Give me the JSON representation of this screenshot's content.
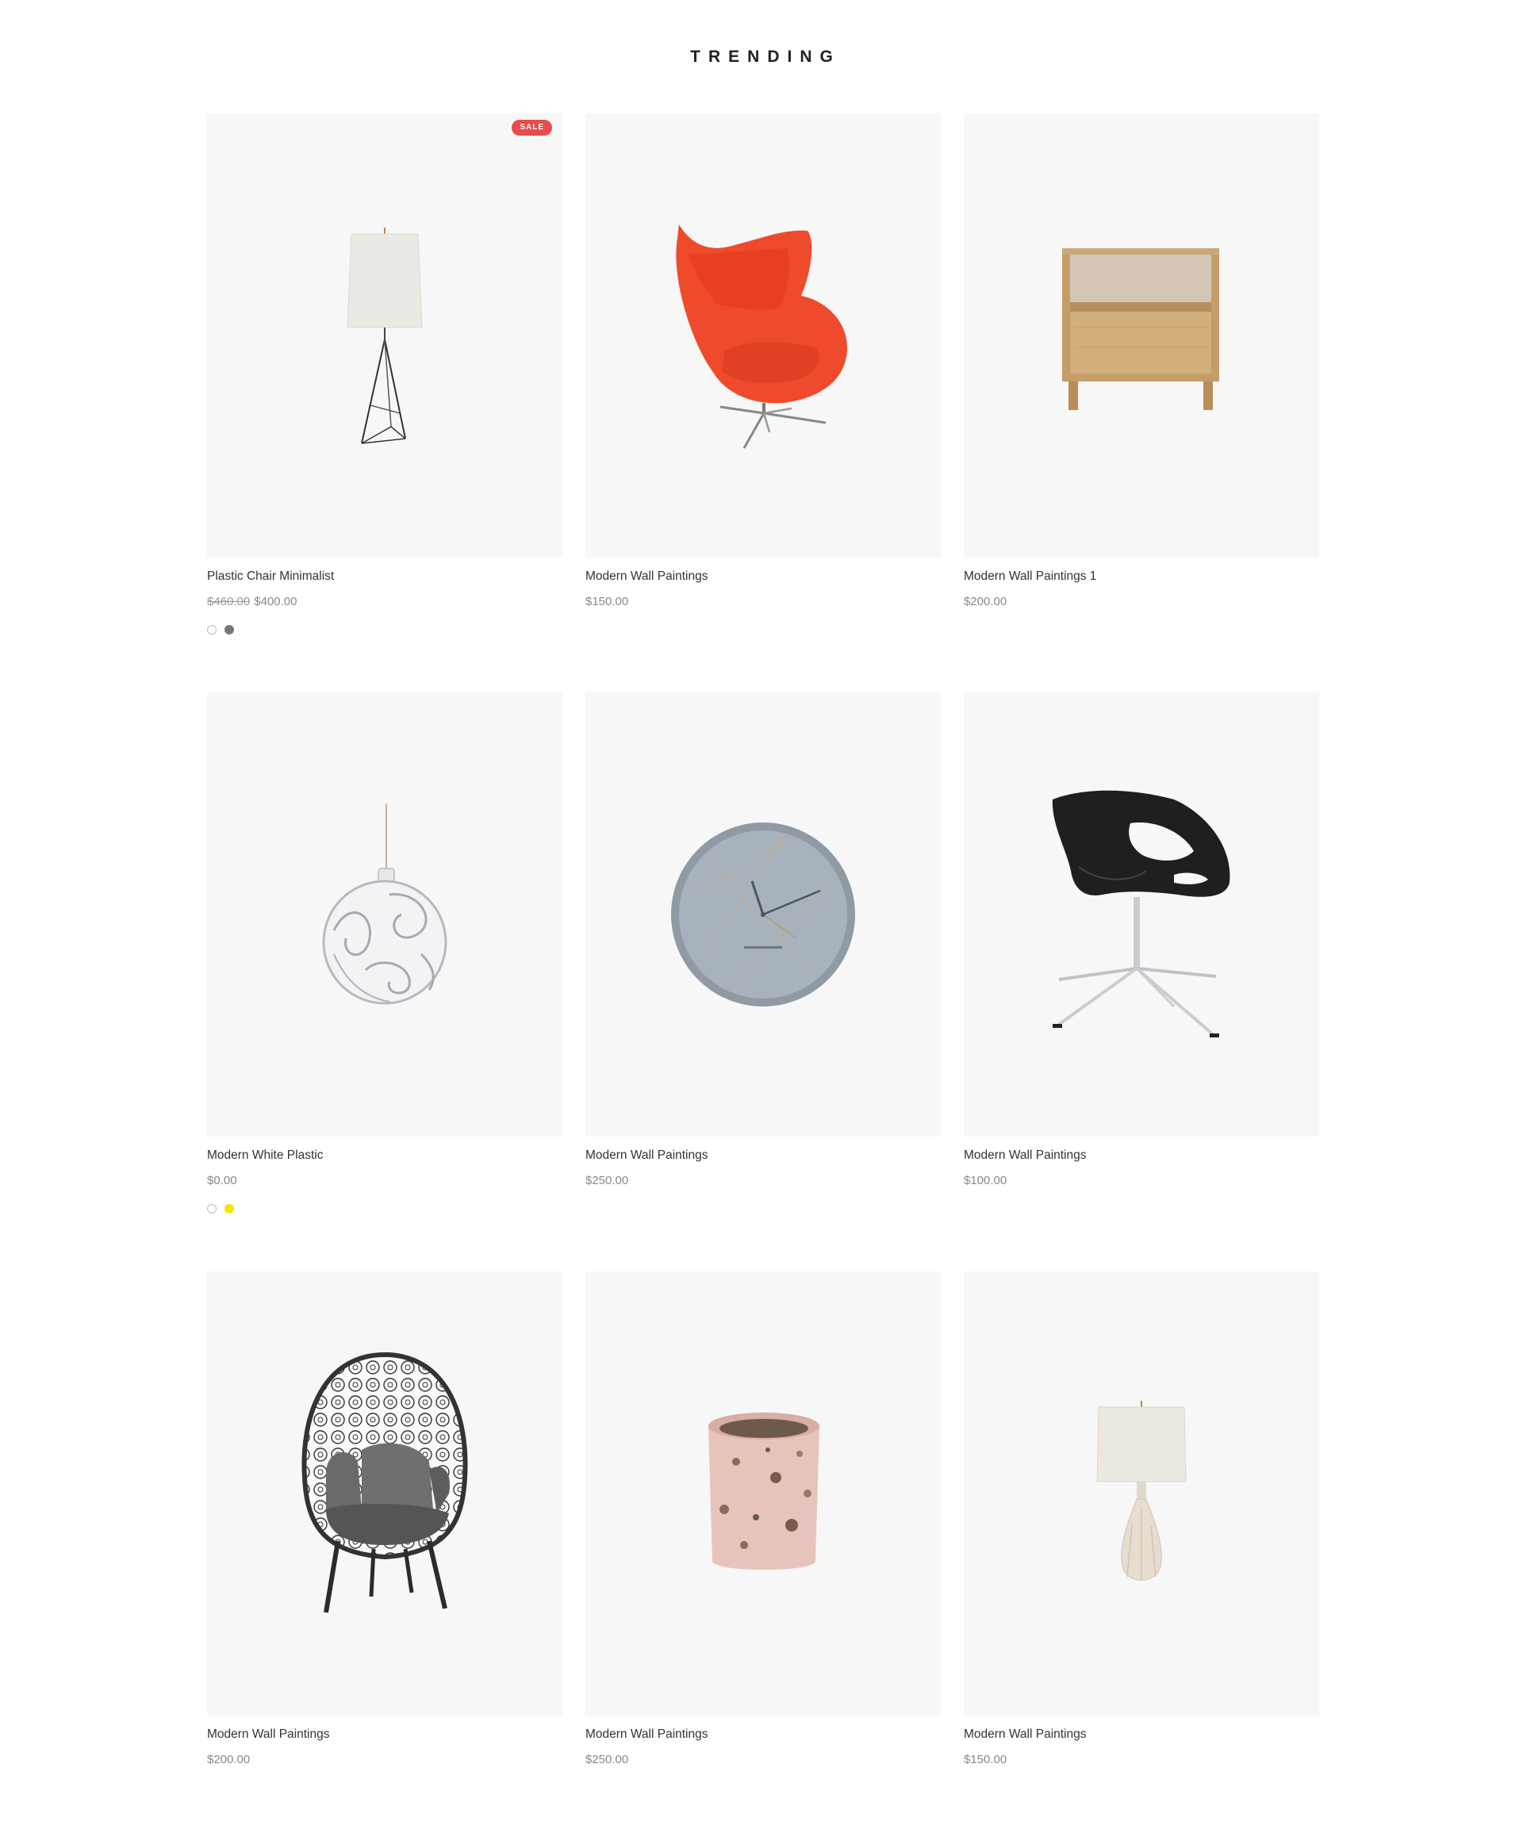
{
  "section": {
    "title": "TRENDING"
  },
  "products": [
    {
      "name": "Plastic Chair Minimalist",
      "old_price": "$460.00",
      "price": "$400.00",
      "badge": "SALE",
      "icon": "floor-lamp",
      "swatches": [
        "#ffffff",
        "#777777"
      ]
    },
    {
      "name": "Modern Wall Paintings",
      "price": "$150.00",
      "icon": "egg-chair"
    },
    {
      "name": "Modern Wall Paintings 1",
      "price": "$200.00",
      "icon": "nightstand"
    },
    {
      "name": "Modern White Plastic",
      "price": "$0.00",
      "icon": "glass-ornament",
      "swatches": [
        "#ffffff",
        "#f5e800"
      ]
    },
    {
      "name": "Modern Wall Paintings",
      "price": "$250.00",
      "icon": "wall-clock"
    },
    {
      "name": "Modern Wall Paintings",
      "price": "$100.00",
      "icon": "swivel-chair"
    },
    {
      "name": "Modern Wall Paintings",
      "price": "$200.00",
      "icon": "egg-lounge-chair"
    },
    {
      "name": "Modern Wall Paintings",
      "price": "$250.00",
      "icon": "terrazzo-candle"
    },
    {
      "name": "Modern Wall Paintings",
      "price": "$150.00",
      "icon": "table-lamp"
    }
  ]
}
